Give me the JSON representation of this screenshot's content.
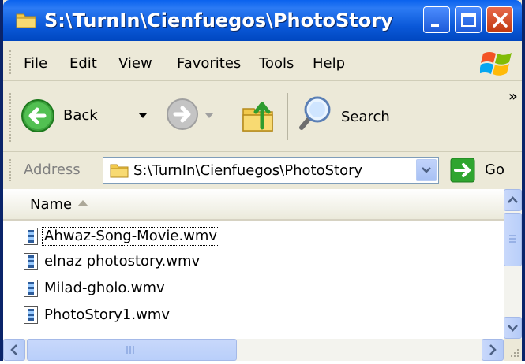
{
  "window": {
    "title": "S:\\TurnIn\\Cienfuegos\\PhotoStory"
  },
  "menu": {
    "items": [
      "File",
      "Edit",
      "View",
      "Favorites",
      "Tools",
      "Help"
    ]
  },
  "toolbar": {
    "back_label": "Back",
    "search_label": "Search",
    "overflow_label": "»"
  },
  "address": {
    "label": "Address",
    "value": "S:\\TurnIn\\Cienfuegos\\PhotoStory",
    "go_label": "Go"
  },
  "list": {
    "column_name": "Name",
    "files": [
      "Ahwaz-Song-Movie.wmv",
      "elnaz photostory.wmv",
      "Milad-gholo.wmv",
      "PhotoStory1.wmv"
    ]
  },
  "colors": {
    "title_bar": "#0A58D8",
    "chrome": "#ECE9D8",
    "close_button": "#C0390F"
  }
}
